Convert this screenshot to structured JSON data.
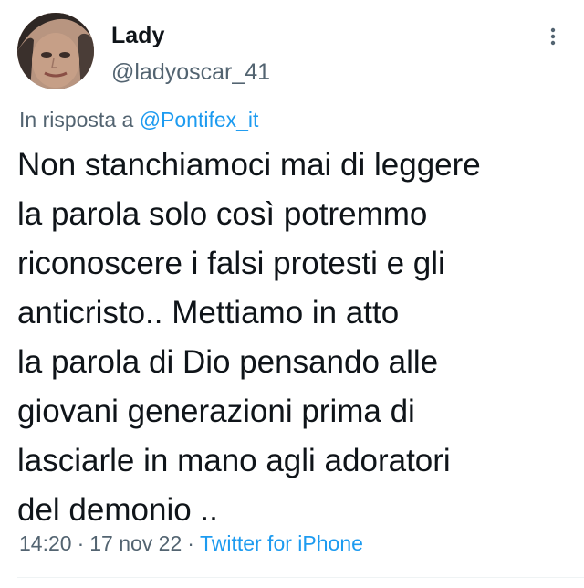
{
  "author": {
    "name": "Lady",
    "handle": "@ladyoscar_41",
    "avatar_icon": "profile-photo"
  },
  "reply_context": {
    "prefix": "In risposta a",
    "mention": "@Pontifex_it"
  },
  "tweet_lines": [
    "Non stanchiamoci mai di leggere",
    "la parola solo così potremmo",
    "riconoscere i falsi protesti e gli",
    "anticristo.. Mettiamo in atto",
    "la parola di Dio pensando alle",
    "giovani generazioni prima di",
    "lasciarle in mano agli adoratori",
    "del demonio .."
  ],
  "meta": {
    "time": "14:20",
    "separator": "·",
    "date": "17 nov 22",
    "source": "Twitter for iPhone"
  },
  "icons": {
    "more": "more-vertical-icon"
  },
  "colors": {
    "text": "#0f1419",
    "secondary": "#536471",
    "link": "#1d9bf0",
    "divider": "#eff3f4"
  }
}
